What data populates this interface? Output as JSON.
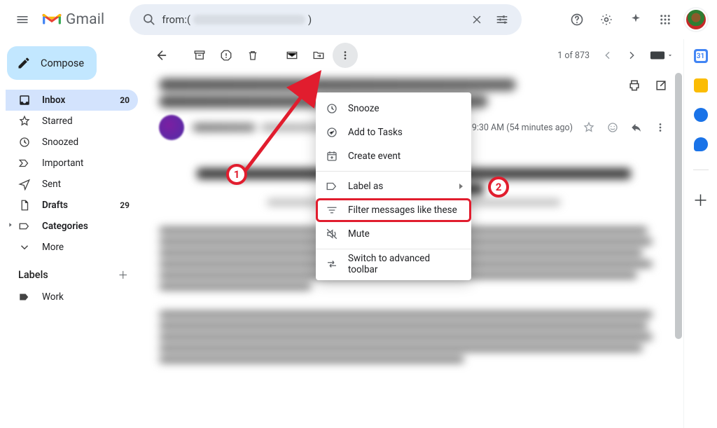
{
  "header": {
    "product": "Gmail",
    "search_prefix": "from:(",
    "search_suffix": ")"
  },
  "compose_label": "Compose",
  "nav": {
    "items": [
      {
        "label": "Inbox",
        "count": "20"
      },
      {
        "label": "Starred",
        "count": ""
      },
      {
        "label": "Snoozed",
        "count": ""
      },
      {
        "label": "Important",
        "count": ""
      },
      {
        "label": "Sent",
        "count": ""
      },
      {
        "label": "Drafts",
        "count": "29"
      },
      {
        "label": "Categories",
        "count": ""
      },
      {
        "label": "More",
        "count": ""
      }
    ],
    "labels_heading": "Labels",
    "labels": [
      {
        "label": "Work"
      }
    ]
  },
  "toolbar": {
    "page_info": "1 of 873"
  },
  "message": {
    "time": "9:30 AM (54 minutes ago)"
  },
  "menu": {
    "snooze": "Snooze",
    "add_to_tasks": "Add to Tasks",
    "create_event": "Create event",
    "label_as": "Label as",
    "filter_like": "Filter messages like these",
    "mute": "Mute",
    "advanced_toolbar": "Switch to advanced toolbar"
  },
  "annotations": {
    "one": "1",
    "two": "2"
  }
}
